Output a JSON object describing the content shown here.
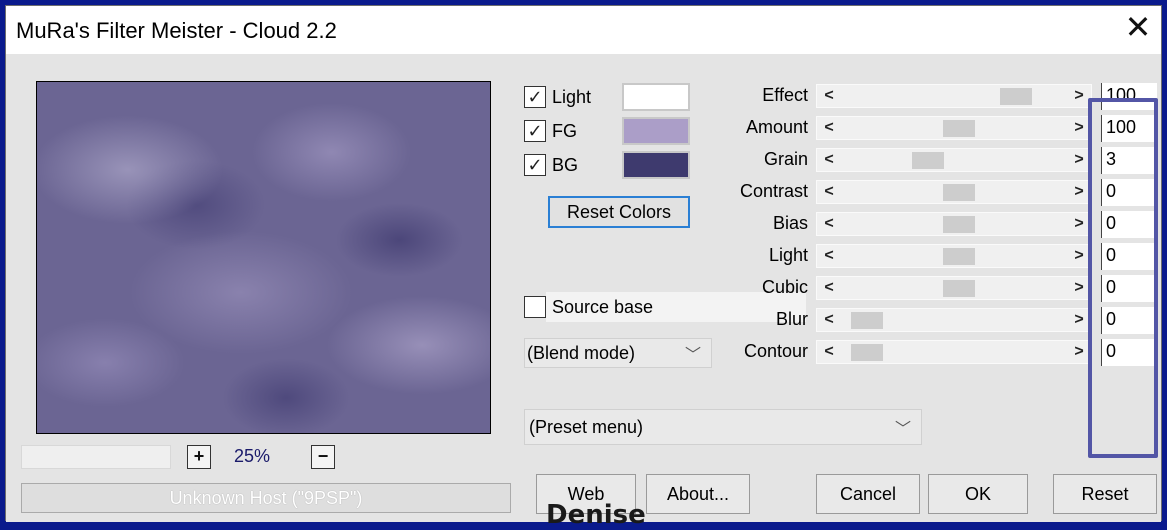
{
  "window": {
    "title": "MuRa's Filter Meister - Cloud 2.2",
    "close_glyph": "✕"
  },
  "preview": {
    "zoom_value": "25%",
    "zoom_in": "+",
    "zoom_out": "−"
  },
  "status": {
    "text": "Unknown Host (\"9PSP\")"
  },
  "colors": {
    "light": {
      "label": "Light",
      "checked": true,
      "swatch": "#ffffff"
    },
    "fg": {
      "label": "FG",
      "checked": true,
      "swatch": "#ab9ec8"
    },
    "bg": {
      "label": "BG",
      "checked": true,
      "swatch": "#3e3a6e"
    },
    "reset_label": "Reset Colors"
  },
  "source_base": {
    "label": "Source base",
    "checked": false
  },
  "blend_mode": {
    "value": "(Blend mode)"
  },
  "preset_menu": {
    "value": "(Preset menu)"
  },
  "sliders": [
    {
      "label": "Effect",
      "value": "100",
      "level": 0.8
    },
    {
      "label": "Amount",
      "value": "100",
      "level": 0.52
    },
    {
      "label": "Grain",
      "value": "3",
      "level": 0.37
    },
    {
      "label": "Contrast",
      "value": "0",
      "level": 0.52
    },
    {
      "label": "Bias",
      "value": "0",
      "level": 0.52
    },
    {
      "label": "Light",
      "value": "0",
      "level": 0.52
    },
    {
      "label": "Cubic",
      "value": "0",
      "level": 0.52
    },
    {
      "label": "Blur",
      "value": "0",
      "level": 0.07
    },
    {
      "label": "Contour",
      "value": "0",
      "level": 0.07
    }
  ],
  "buttons": {
    "web": "Web",
    "about": "About...",
    "cancel": "Cancel",
    "ok": "OK",
    "reset": "Reset"
  },
  "watermark": "Denise"
}
